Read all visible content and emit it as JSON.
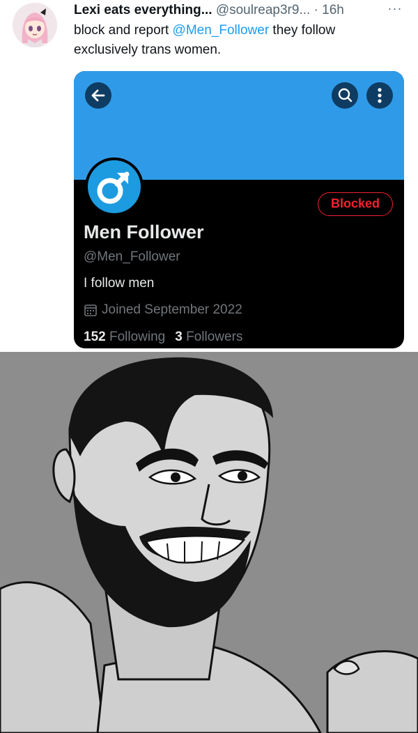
{
  "tweet": {
    "author_name": "Lexi eats everything...",
    "author_handle": "@soulreap3r9...",
    "separator": "·",
    "time": "16h",
    "more_label": "···",
    "text_before": "block and report ",
    "mention": "@Men_Follower",
    "text_after": " they follow exclusively trans women."
  },
  "profile": {
    "blocked_label": "Blocked",
    "display_name": "Men Follower",
    "handle": "@Men_Follower",
    "bio": "I follow men",
    "joined": "Joined September 2022",
    "following_count": "152",
    "following_label": "Following",
    "followers_count": "3",
    "followers_label": "Followers",
    "icons": {
      "back": "arrow-left-icon",
      "search": "search-icon",
      "more": "more-vertical-icon",
      "avatar": "male-symbol-icon",
      "joined": "calendar-icon"
    }
  },
  "colors": {
    "link": "#1d9bf0",
    "banner": "#2f9be8",
    "blocked": "#f4212e",
    "card_bg": "#000000"
  }
}
